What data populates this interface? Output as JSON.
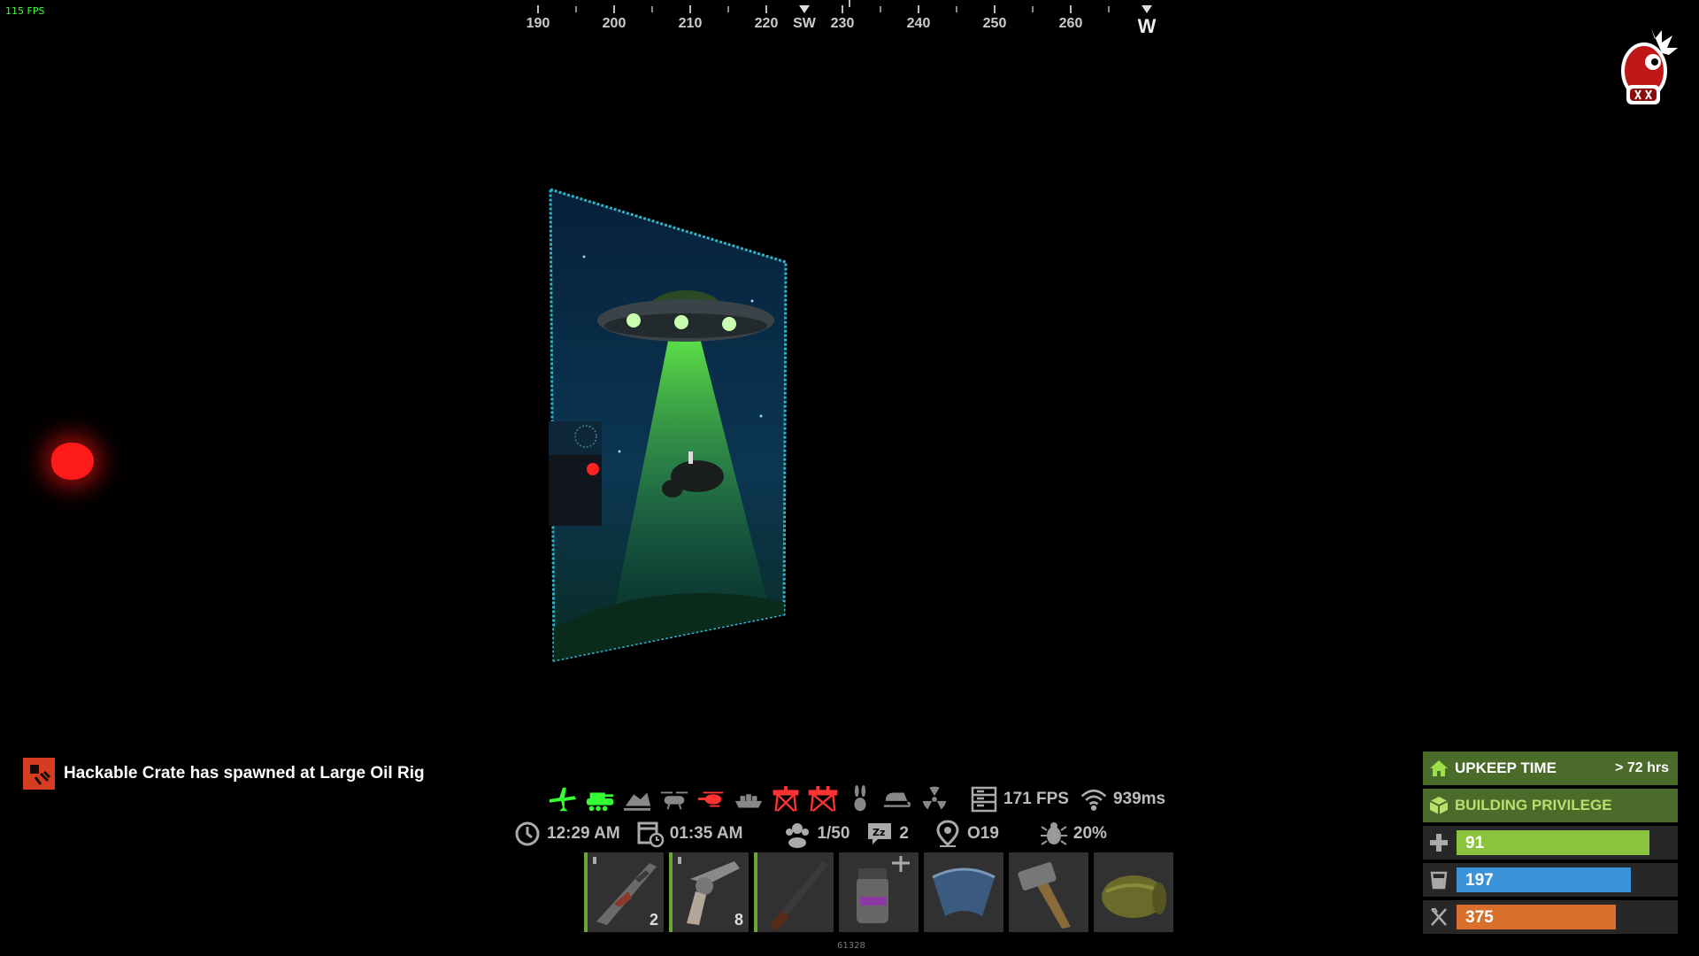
{
  "top_fps": "115 FPS",
  "compass": {
    "labels": [
      {
        "text": "190",
        "big": false
      },
      {
        "text": "200",
        "big": false
      },
      {
        "text": "210",
        "big": false
      },
      {
        "text": "220",
        "big": false
      },
      {
        "text": "SW",
        "big": false
      },
      {
        "text": "230",
        "big": false
      },
      {
        "text": "240",
        "big": false
      },
      {
        "text": "250",
        "big": false
      },
      {
        "text": "260",
        "big": false
      },
      {
        "text": "W",
        "big": true
      }
    ]
  },
  "notification": {
    "text": "Hackable Crate has spawned at Large Oil Rig",
    "icon": "crate-event-icon",
    "color": "#d63c22"
  },
  "events": {
    "icons": [
      {
        "name": "airdrop-plane-icon",
        "color": "#33ff33"
      },
      {
        "name": "bradley-tank-icon",
        "color": "#33ff33"
      },
      {
        "name": "crashed-heli-icon",
        "color": "#888888"
      },
      {
        "name": "chinook-icon",
        "color": "#888888"
      },
      {
        "name": "patrol-heli-icon",
        "color": "#ff3333"
      },
      {
        "name": "cargo-ship-icon",
        "color": "#888888"
      },
      {
        "name": "small-oil-rig-icon",
        "color": "#ff3333"
      },
      {
        "name": "large-oil-rig-icon",
        "color": "#ff3333"
      },
      {
        "name": "bunny-icon",
        "color": "#888888"
      },
      {
        "name": "santa-sleigh-icon",
        "color": "#888888"
      },
      {
        "name": "radiation-icon",
        "color": "#888888"
      }
    ],
    "server_fps": "171 FPS",
    "ping": "939ms"
  },
  "info": {
    "game_time": "12:29 AM",
    "real_time": "01:35 AM",
    "players": "1/50",
    "sleepers": "2",
    "grid": "O19",
    "bugs_pct": "20%"
  },
  "hotbar": {
    "slots": [
      {
        "item": "assault-rifle-icon",
        "count": "2",
        "bar": true,
        "pip": true
      },
      {
        "item": "revolver-icon",
        "count": "8",
        "bar": true,
        "pip": true
      },
      {
        "item": "shotgun-icon",
        "count": "",
        "bar": true,
        "pip": false
      },
      {
        "item": "smoke-grenade-icon",
        "count": "",
        "bar": false,
        "pip": false
      },
      {
        "item": "roof-icon",
        "count": "",
        "bar": false,
        "pip": false
      },
      {
        "item": "hammer-icon",
        "count": "",
        "bar": false,
        "pip": false
      },
      {
        "item": "sleeping-bag-icon",
        "count": "",
        "bar": false,
        "pip": false
      }
    ],
    "id_text": "61328"
  },
  "panel": {
    "upkeep_label": "UPKEEP TIME",
    "upkeep_value": "> 72 hrs",
    "privilege_label": "BUILDING PRIVILEGE",
    "health": {
      "value": "91",
      "fraction": 0.91,
      "color": "#8ac43f"
    },
    "water": {
      "value": "197",
      "fraction": 0.82,
      "color": "#3a92d8"
    },
    "food": {
      "value": "375",
      "fraction": 0.75,
      "color": "#d8702c"
    }
  }
}
